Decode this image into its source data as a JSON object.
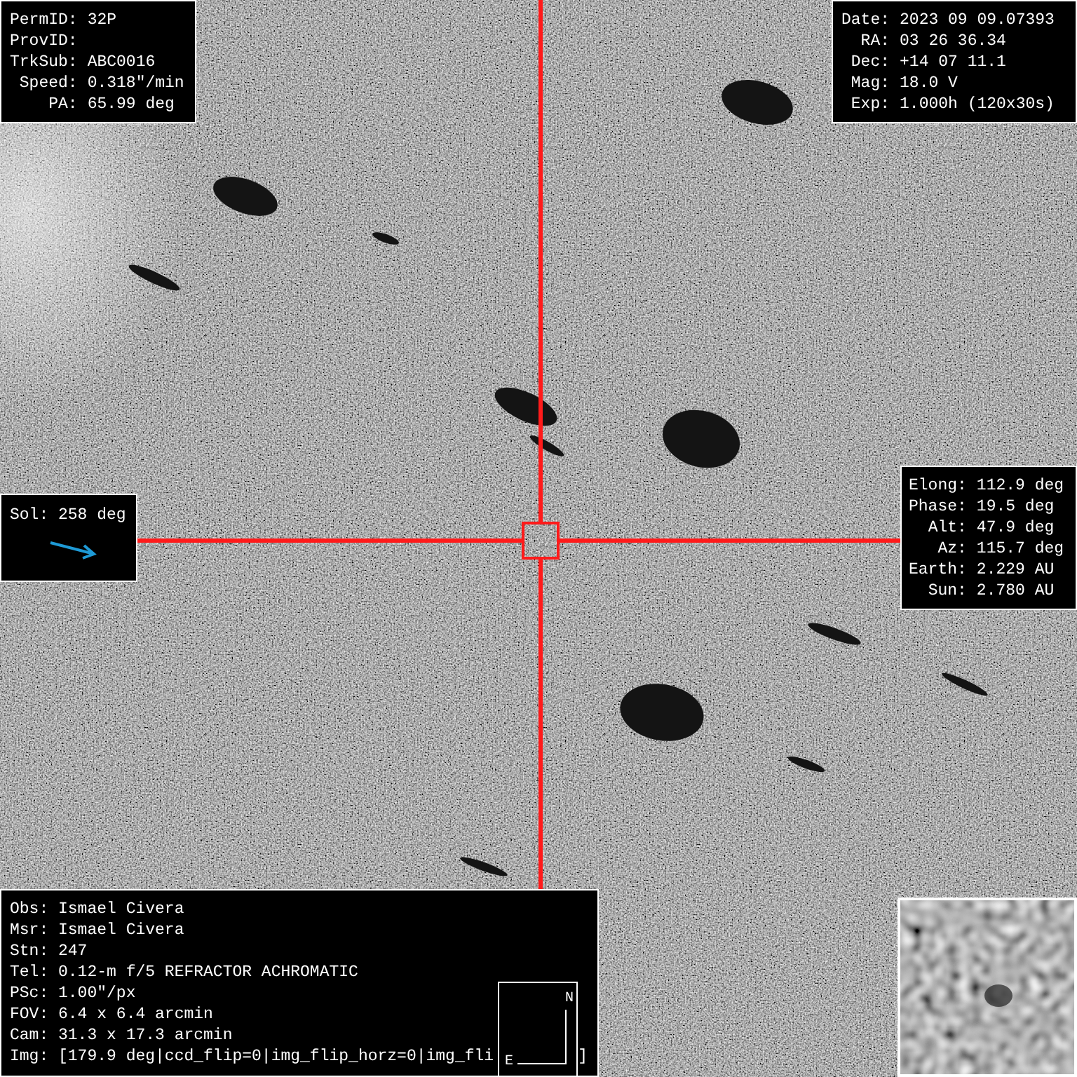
{
  "object_panel": [
    {
      "label": "PermID:",
      "value": "32P"
    },
    {
      "label": "ProvID:"
    },
    {
      "label": "TrkSub:",
      "value": "ABC0016"
    },
    {
      "label": "Speed:",
      "value": "0.318\"/min"
    },
    {
      "label": "PA:",
      "value": "65.99 deg"
    }
  ],
  "observation_panel": [
    {
      "label": "Date:",
      "value": "2023 09 09.07393"
    },
    {
      "label": "RA:",
      "value": "03 26 36.34"
    },
    {
      "label": "Dec:",
      "value": "+14 07 11.1"
    },
    {
      "label": "Mag:",
      "value": "18.0 V"
    },
    {
      "label": "Exp:",
      "value": "1.000h (120x30s)"
    }
  ],
  "sol_panel": {
    "text": "Sol: 258 deg"
  },
  "geometry_panel": [
    {
      "label": "Elong:",
      "value": "112.9 deg"
    },
    {
      "label": "Phase:",
      "value": "19.5 deg"
    },
    {
      "label": "Alt:",
      "value": "47.9 deg"
    },
    {
      "label": "Az:",
      "value": "115.7 deg"
    },
    {
      "label": "Earth:",
      "value": "2.229 AU"
    },
    {
      "label": "Sun:",
      "value": "2.780 AU"
    }
  ],
  "station_panel": {
    "lines": [
      "Obs: Ismael Civera",
      "Msr: Ismael Civera",
      "Stn: 247",
      "Tel: 0.12-m f/5 REFRACTOR ACHROMATIC",
      "PSc: 1.00\"/px",
      "FOV: 6.4 x 6.4 arcmin",
      "Cam: 31.3 x 17.3 arcmin"
    ],
    "last_line": "Img: [179.9 deg|ccd_flip=0|img_flip_horz=0|img_fli",
    "last_line_end": "]"
  },
  "compass": {
    "north": "N",
    "east": "E"
  }
}
